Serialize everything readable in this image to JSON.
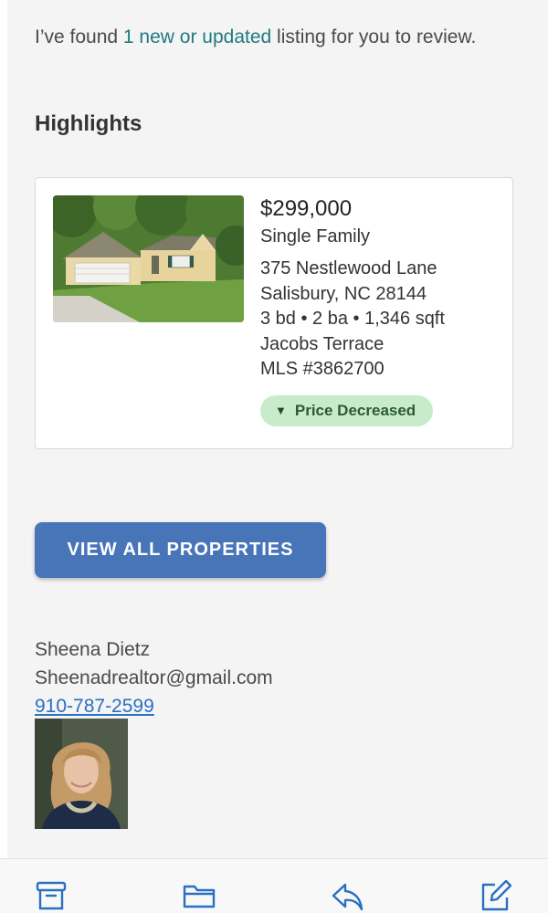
{
  "intro": {
    "prefix": "I’ve found ",
    "link": "1 new or updated",
    "suffix": " listing for you to review."
  },
  "highlights": {
    "heading": "Highlights"
  },
  "listing": {
    "price": "$299,000",
    "property_type": "Single Family",
    "address_line1": "375 Nestlewood Lane",
    "address_line2": "Salisbury, NC 28144",
    "specs": "3 bd • 2 ba • 1,346 sqft",
    "subdivision": "Jacobs Terrace",
    "mls": "MLS #3862700",
    "badge": "Price Decreased",
    "badge_icon": "triangle-down-icon"
  },
  "cta": {
    "label": "VIEW ALL PROPERTIES"
  },
  "agent": {
    "name": "Sheena Dietz",
    "email": "Sheenadrealtor@gmail.com",
    "phone": "910-787-2599"
  },
  "toolbar": {
    "icons": [
      "archive-icon",
      "folder-icon",
      "reply-icon",
      "compose-icon"
    ],
    "accent": "#2a6fc2"
  },
  "colors": {
    "link": "#1f7a80",
    "button": "#4874b8",
    "badge_bg": "#c8ecca",
    "badge_text": "#2d5a32"
  }
}
